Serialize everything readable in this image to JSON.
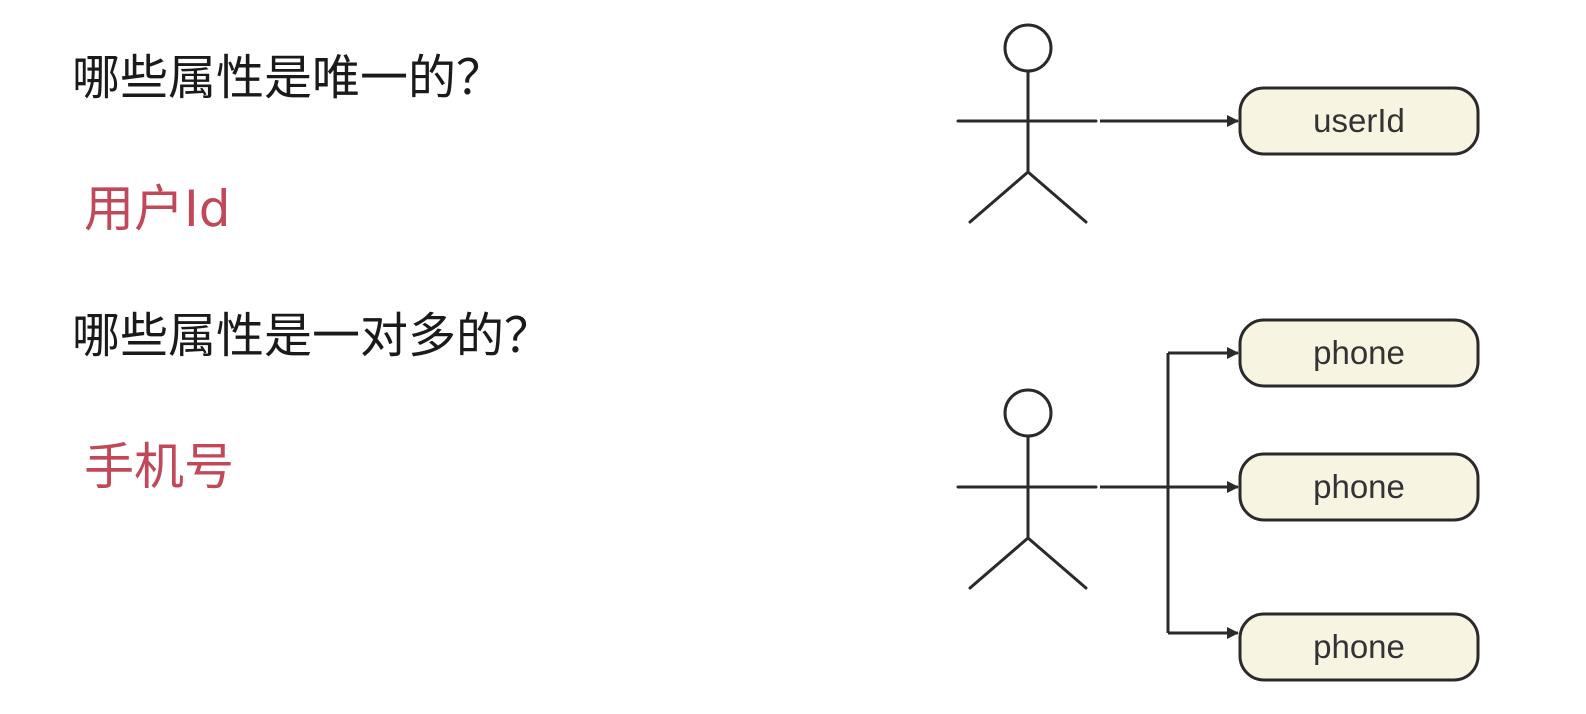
{
  "questions": {
    "unique": {
      "question": "哪些属性是唯一的？",
      "answer": "用户Id"
    },
    "one_to_many": {
      "question": "哪些属性是一对多的？",
      "answer": "手机号"
    }
  },
  "diagram": {
    "unique_node": {
      "label": "userId"
    },
    "many_nodes": [
      {
        "label": "phone"
      },
      {
        "label": "phone"
      },
      {
        "label": "phone"
      }
    ]
  },
  "colors": {
    "answer_text": "#c04858",
    "node_fill": "#f8f4e2",
    "stroke": "#2a2a2a"
  }
}
